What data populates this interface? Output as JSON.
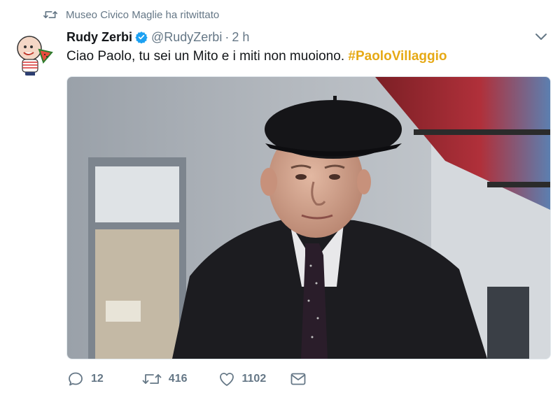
{
  "retweet_context": {
    "icon": "retweet-icon",
    "text": "Museo Civico Maglie ha ritwittato"
  },
  "tweet": {
    "author_name": "Rudy Zerbi",
    "verified": true,
    "handle": "@RudyZerbi",
    "separator": "·",
    "time": "2 h",
    "text": "Ciao Paolo, tu sei un Mito e i miti non muoiono.",
    "hashtag": "#PaoloVillaggio",
    "hashtag_color": "#e6a915"
  },
  "actions": {
    "reply_count": "12",
    "retweet_count": "416",
    "like_count": "1102"
  },
  "colors": {
    "secondary_text": "#657786",
    "verified_blue": "#1da1f2"
  }
}
